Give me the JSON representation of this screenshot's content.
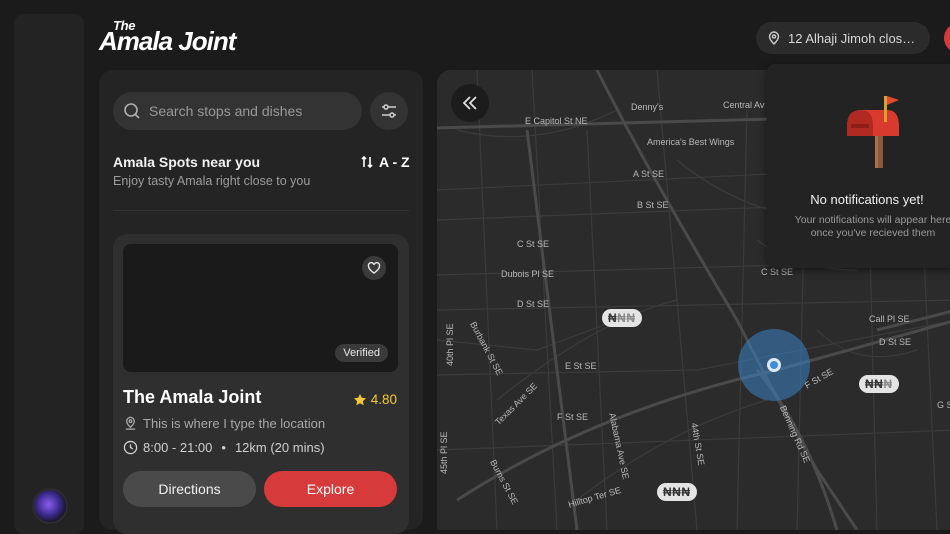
{
  "app": {
    "logo_small": "The",
    "logo_main": "Amala Joint"
  },
  "header": {
    "location_text": "12 Alhaji Jimoh close..."
  },
  "sidebar_panel": {
    "search_placeholder": "Search stops and dishes",
    "section_title": "Amala Spots near you",
    "section_subtitle": "Enjoy tasty Amala right close to you",
    "sort_label": "A - Z",
    "card": {
      "badge": "Verified",
      "name": "The Amala Joint",
      "rating": "4.80",
      "location": "This is where I type the location",
      "hours": "8:00 - 21:00",
      "distance": "12km (20 mins)",
      "directions_label": "Directions",
      "explore_label": "Explore"
    }
  },
  "map": {
    "streets": [
      "E Capitol St NE",
      "Denny's",
      "Central Av",
      "America's Best Wings",
      "A St SE",
      "B St SE",
      "C St SE",
      "C St SE",
      "Dubois Pl SE",
      "D St SE",
      "D St SE",
      "Burbank St SE",
      "40th Pl SE",
      "E St SE",
      "F St SE",
      "F St SE",
      "Texas Ave SE",
      "Alabama Ave SE",
      "44th St SE",
      "Benning Rd SE",
      "Burns St SE",
      "Hilltop Ter SE",
      "Call Pl SE",
      "G St SE",
      "45th Pl SE"
    ],
    "price_tags": [
      {
        "active": "₦",
        "inactive": "₦₦"
      },
      {
        "active": "₦₦",
        "inactive": "₦"
      },
      {
        "active": "₦₦₦",
        "inactive": ""
      }
    ]
  },
  "notifications": {
    "title": "No notifications yet!",
    "text": "Your notifications will appear here once you've recieved them"
  },
  "colors": {
    "accent": "#d63a3a",
    "star": "#f3c93b",
    "location": "#3b8fd9"
  }
}
